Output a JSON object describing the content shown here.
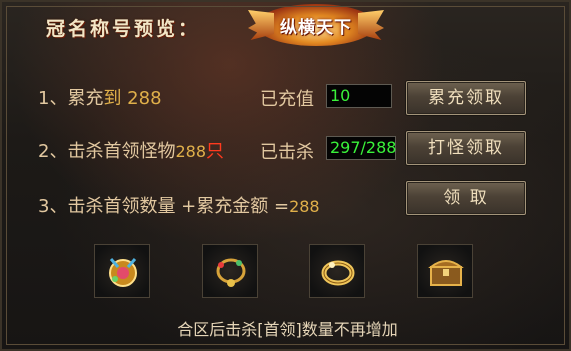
{
  "header": {
    "title": "冠名称号预览：",
    "badge_text": "纵横天下"
  },
  "rows": [
    {
      "number": "1、",
      "text": "累充",
      "highlight": "到 288",
      "status_label": "已充值",
      "status_value": "10",
      "button_label": "累充领取"
    },
    {
      "number": "2、",
      "text": "击杀首领怪物",
      "count": "288",
      "unit": "只",
      "status_label": "已击杀",
      "status_value": "297/288",
      "button_label": "打怪领取"
    },
    {
      "number": "3、",
      "text": "击杀首领数量 +累充金额 =",
      "count": "288",
      "button_label": "领 取"
    }
  ],
  "rewards": [
    {
      "icon": "medal-icon"
    },
    {
      "icon": "necklace-icon"
    },
    {
      "icon": "bracelet-icon"
    },
    {
      "icon": "treasure-chest-icon"
    }
  ],
  "footer": {
    "note": "合区后击杀[首领]数量不再增加"
  },
  "colors": {
    "label": "#e2c8a0",
    "gold": "#e0b04a",
    "red": "#ff3a1e",
    "value_green": "#3af23a"
  }
}
